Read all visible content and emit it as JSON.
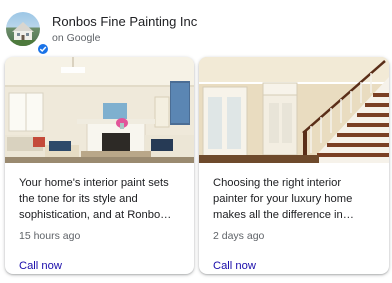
{
  "business": {
    "name": "Ronbos Fine Painting Inc",
    "source": "on Google",
    "verified": true
  },
  "posts": [
    {
      "text": "Your home's interior paint sets the tone for its style and sophistication, and at Ronbo…",
      "time": "15 hours ago",
      "action_label": "Call now",
      "image": "living-room-photo"
    },
    {
      "text": "Choosing the right interior painter for your luxury home makes all the difference in…",
      "time": "2 days ago",
      "action_label": "Call now",
      "image": "staircase-photo"
    }
  ],
  "colors": {
    "link": "#1a0dab",
    "secondary_text": "#5f6368",
    "verified_badge": "#1a73e8"
  }
}
